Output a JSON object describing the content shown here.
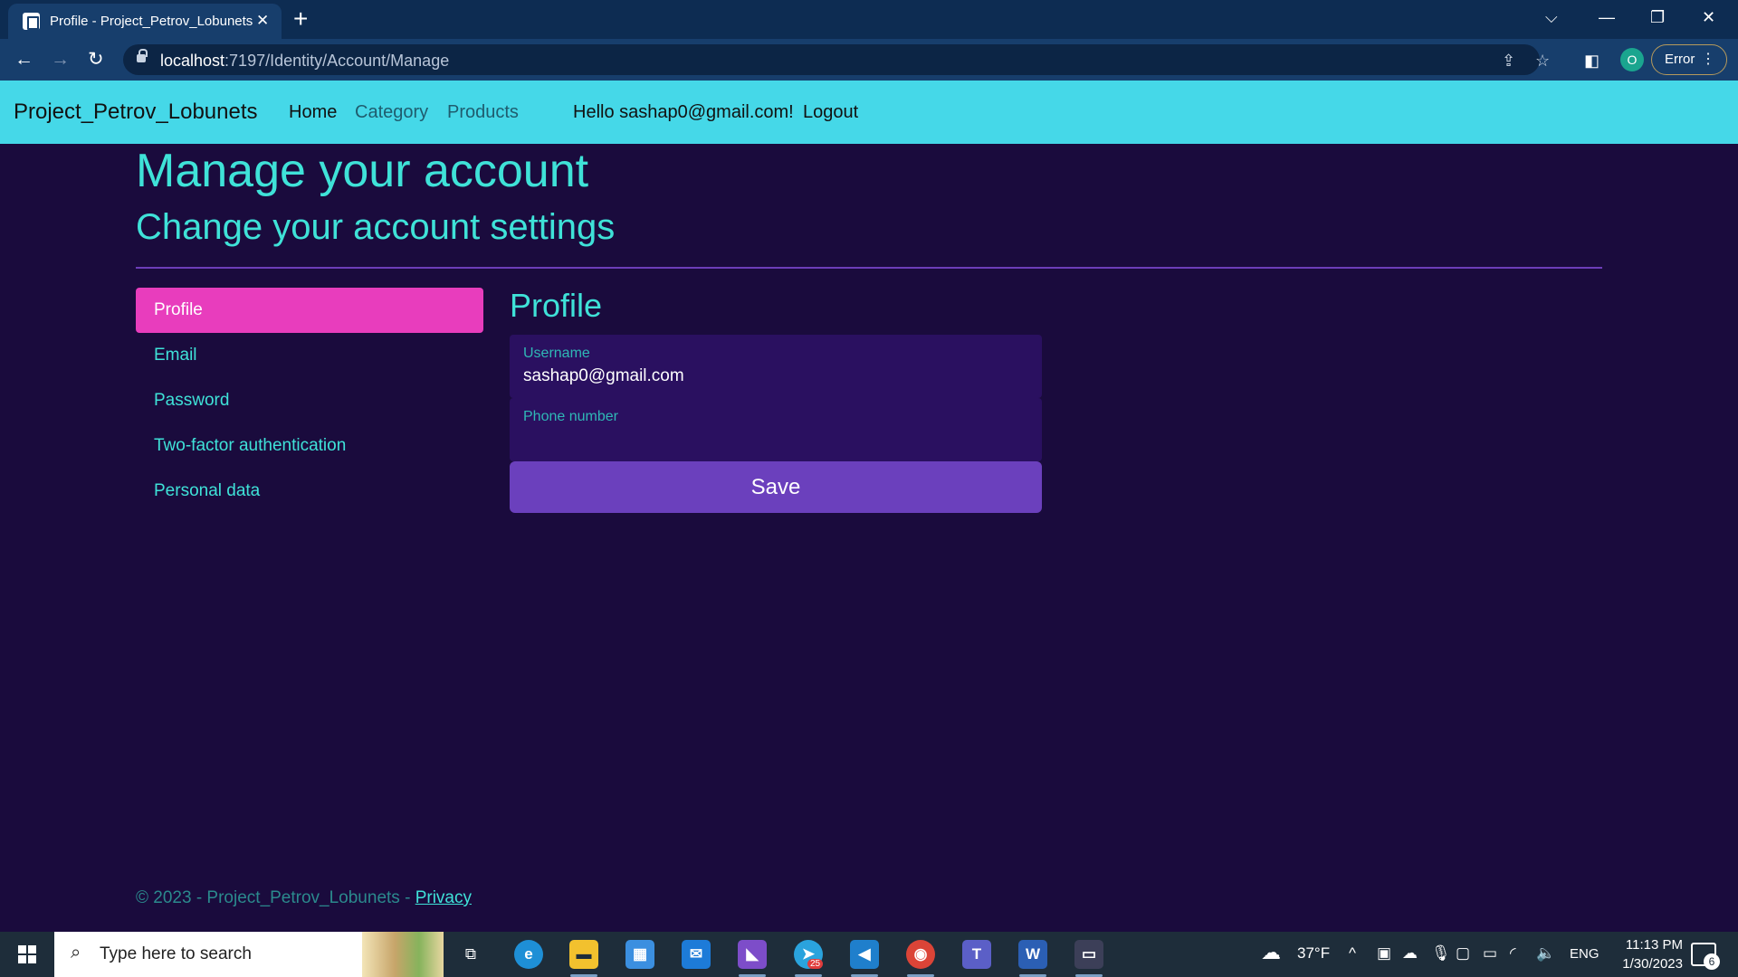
{
  "browser": {
    "tab_title": "Profile - Project_Petrov_Lobunets",
    "tab_close": "✕",
    "new_tab": "+",
    "url_host": "localhost",
    "url_path": ":7197/Identity/Account/Manage",
    "profile_initial": "O",
    "error_label": "Error"
  },
  "site": {
    "brand": "Project_Petrov_Lobunets",
    "nav": {
      "home": "Home",
      "category": "Category",
      "products": "Products",
      "greeting": "Hello sashap0@gmail.com!",
      "logout": "Logout"
    }
  },
  "page": {
    "title": "Manage your account",
    "subtitle": "Change your account settings",
    "sidebar": [
      {
        "label": "Profile",
        "active": true
      },
      {
        "label": "Email"
      },
      {
        "label": "Password"
      },
      {
        "label": "Two-factor authentication"
      },
      {
        "label": "Personal data"
      }
    ],
    "section_title": "Profile",
    "form": {
      "username_label": "Username",
      "username_value": "sashap0@gmail.com",
      "phone_label": "Phone number",
      "phone_value": "",
      "save_label": "Save"
    }
  },
  "footer": {
    "text": "© 2023 - Project_Petrov_Lobunets - ",
    "privacy": "Privacy"
  },
  "taskbar": {
    "search_placeholder": "Type here to search",
    "weather": "37°F",
    "language": "ENG",
    "time": "11:13 PM",
    "date": "1/30/2023",
    "telegram_badge": "25",
    "notifications": "6"
  },
  "colors": {
    "page_bg": "#1a0b3d",
    "navbar": "#45d8e8",
    "accent_cyan": "#3fe2d8",
    "active_pink": "#e83dbd",
    "button_purple": "#6b40bd"
  }
}
